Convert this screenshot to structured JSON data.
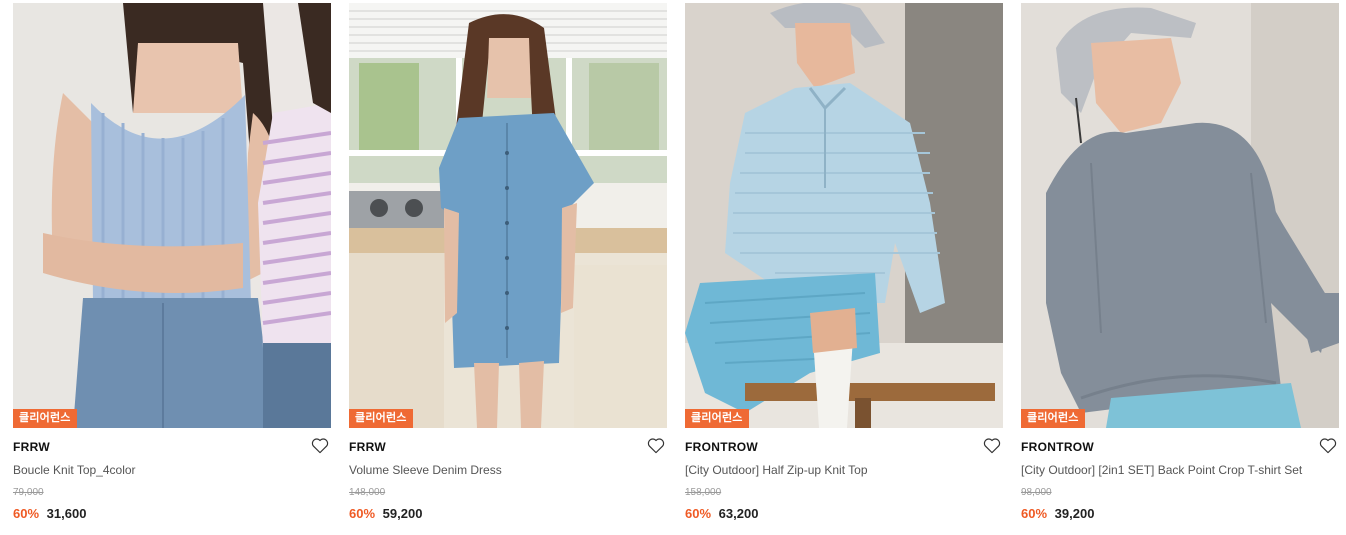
{
  "products": [
    {
      "badge": "클리어런스",
      "brand": "FRRW",
      "name": "Boucle Knit Top_4color",
      "original_price": "79,000",
      "discount": "60%",
      "sale_price": "31,600",
      "wishlist_icon": "heart-outline-icon"
    },
    {
      "badge": "클리어런스",
      "brand": "FRRW",
      "name": "Volume Sleeve Denim Dress",
      "original_price": "148,000",
      "discount": "60%",
      "sale_price": "59,200",
      "wishlist_icon": "heart-outline-icon"
    },
    {
      "badge": "클리어런스",
      "brand": "FRONTROW",
      "name": "[City Outdoor] Half Zip-up Knit Top",
      "original_price": "158,000",
      "discount": "60%",
      "sale_price": "63,200",
      "wishlist_icon": "heart-outline-icon"
    },
    {
      "badge": "클리어런스",
      "brand": "FRONTROW",
      "name": "[City Outdoor] [2in1 SET] Back Point Crop T-shirt Set",
      "original_price": "98,000",
      "discount": "60%",
      "sale_price": "39,200",
      "wishlist_icon": "heart-outline-icon"
    }
  ],
  "colors": {
    "badge_bg": "#ef6a34",
    "discount_text": "#ef5a24"
  }
}
